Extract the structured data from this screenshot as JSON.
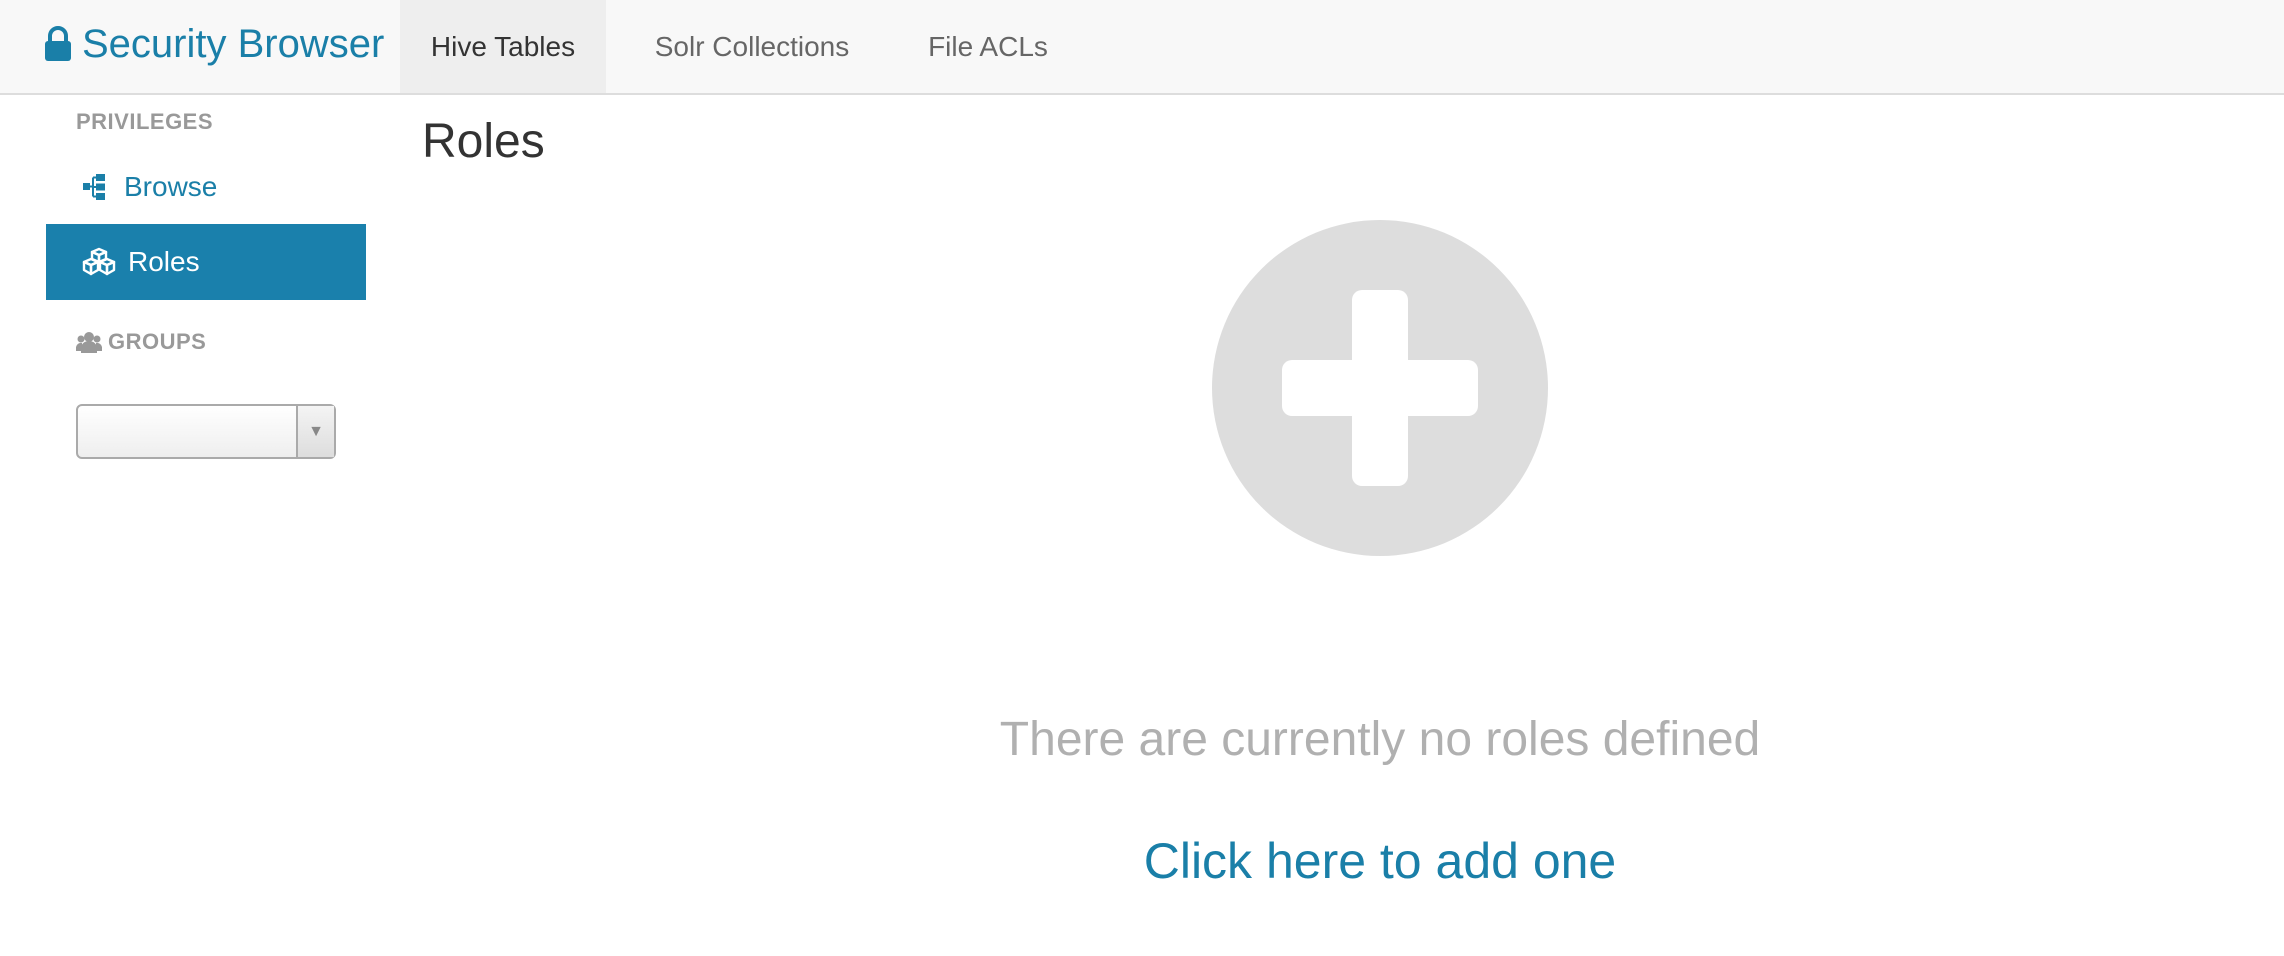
{
  "navbar": {
    "brand": "Security Browser",
    "tabs": [
      {
        "label": "Hive Tables",
        "active": true
      },
      {
        "label": "Solr Collections",
        "active": false
      },
      {
        "label": "File ACLs",
        "active": false
      }
    ]
  },
  "sidebar": {
    "privileges_header": "PRIVILEGES",
    "items": [
      {
        "label": "Browse",
        "icon": "sitemap-icon",
        "active": false
      },
      {
        "label": "Roles",
        "icon": "cubes-icon",
        "active": true
      }
    ],
    "groups_header": "GROUPS",
    "groups_select": {
      "value": ""
    }
  },
  "main": {
    "title": "Roles",
    "empty_message": "There are currently no roles defined",
    "add_link": "Click here to add one"
  },
  "colors": {
    "accent": "#1a7fa8",
    "active_item_bg": "#1a80ac",
    "navbar_bg": "#f8f8f8",
    "placeholder_circle": "#dddddd",
    "muted_text": "#b0b0b0"
  }
}
